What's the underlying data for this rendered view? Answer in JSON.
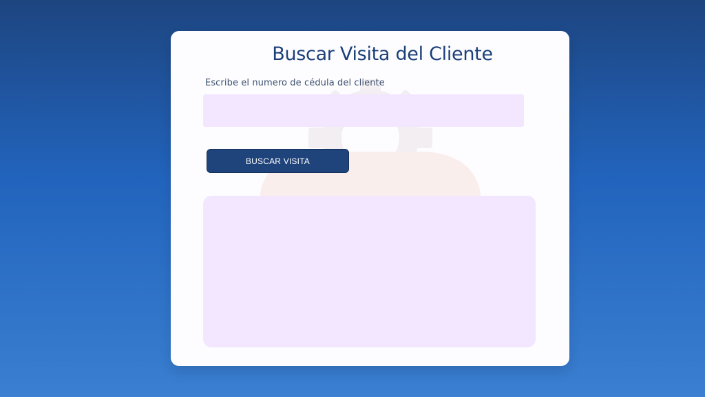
{
  "page": {
    "title": "Buscar Visita del Cliente"
  },
  "form": {
    "label": "Escribe el numero de cédula del cliente",
    "cedula_value": "",
    "cedula_placeholder": "",
    "search_button_label": "BUSCAR VISITA"
  },
  "results": {
    "content": ""
  },
  "colors": {
    "background_top": "#1d4580",
    "background_bottom": "#3a7fd1",
    "card": "#fdfdff",
    "title": "#1c3f7a",
    "field_fill": "#f3e6ff",
    "button": "#1f447c"
  },
  "icons": {
    "watermark": "car-gear-logo-icon"
  }
}
